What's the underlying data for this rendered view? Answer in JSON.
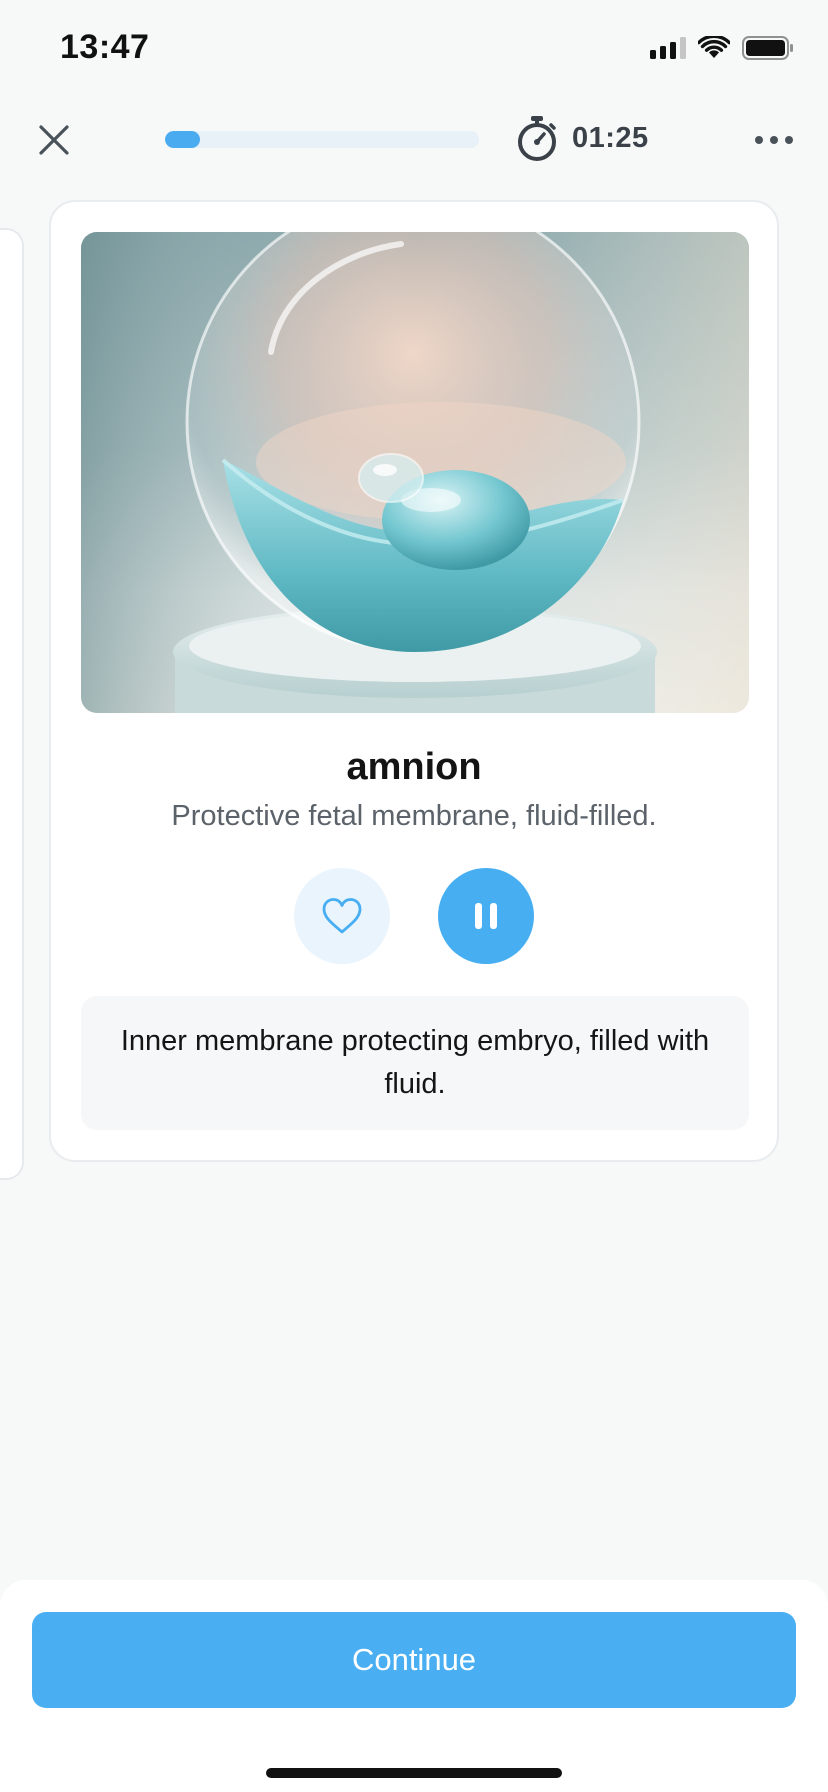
{
  "status_bar": {
    "time": "13:47",
    "icons": [
      "cellular-signal-icon",
      "wifi-icon",
      "battery-icon"
    ]
  },
  "top_bar": {
    "close_icon": "close-icon",
    "progress": 0.11,
    "timer_icon": "stopwatch-icon",
    "timer": "01:25",
    "more_icon": "more-horizontal-icon"
  },
  "card": {
    "image_icon": "amnion-illustration",
    "term": "amnion",
    "subtitle": "Protective fetal membrane, fluid-filled.",
    "favorite_icon": "heart-icon",
    "pause_icon": "pause-icon",
    "definition": "Inner membrane protecting embryo, filled with fluid."
  },
  "footer": {
    "continue_label": "Continue"
  },
  "colors": {
    "accent": "#4aaff2",
    "progress_track": "#e8f1f8",
    "favorite_bg": "#eaf4fd",
    "background": "#f7f8f8"
  }
}
